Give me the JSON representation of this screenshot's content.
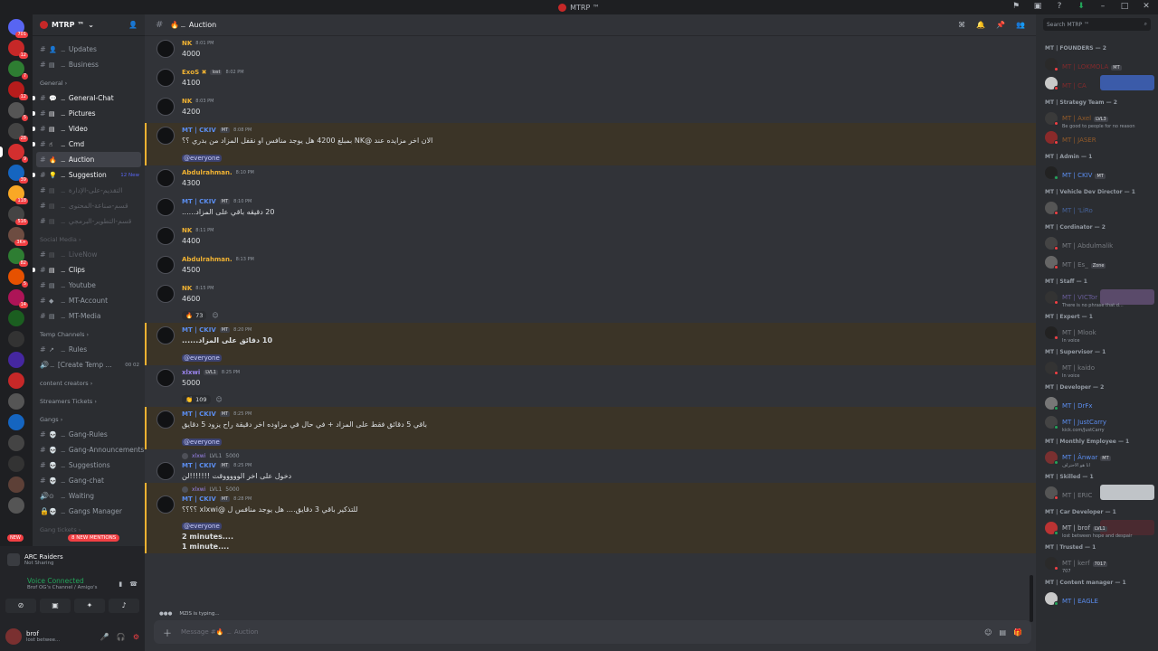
{
  "window": {
    "title": "MTRP ™"
  },
  "server": {
    "name": "MTRP ™"
  },
  "guild_badges": [
    "701",
    "12",
    "7",
    "12",
    "5",
    "28",
    "9",
    "39",
    "118",
    "516",
    "3K+",
    "82",
    "5",
    "14"
  ],
  "channels": {
    "top": [
      {
        "emoji": "👤",
        "name": "Updates"
      },
      {
        "emoji": "▤",
        "name": "Business"
      }
    ],
    "general_category": "General",
    "general": [
      {
        "emoji": "💬",
        "name": "General-Chat",
        "unread": true
      },
      {
        "emoji": "▤",
        "name": "Pictures",
        "unread": true
      },
      {
        "emoji": "▤",
        "name": "Video",
        "unread": true
      },
      {
        "emoji": "☝",
        "name": "Cmd",
        "unread": true
      },
      {
        "emoji": "🔥",
        "name": "Auction",
        "selected": true
      },
      {
        "emoji": "💡",
        "name": "Suggestion",
        "unread": true,
        "right": "12 New"
      },
      {
        "emoji": "▤",
        "name": "التقديم-على-الإدارة",
        "muted": true
      },
      {
        "emoji": "▤",
        "name": "قسم-صناعة-المحتوى",
        "muted": true
      },
      {
        "emoji": "▤",
        "name": "قسم-التطوير-البرمجي",
        "muted": true
      }
    ],
    "social_category": "Social Media",
    "social": [
      {
        "emoji": "▤",
        "name": "LiveNow",
        "muted": true
      },
      {
        "emoji": "▤",
        "name": "Clips",
        "unread": true
      },
      {
        "emoji": "▤",
        "name": "Youtube"
      },
      {
        "emoji": "◆",
        "name": "MT-Account"
      },
      {
        "emoji": "▤",
        "name": "MT-Media"
      }
    ],
    "temp_category": "Temp Channels",
    "temp": [
      {
        "emoji": "↗",
        "name": "Rules"
      },
      {
        "emoji": "",
        "name": "[Create Temp ...",
        "voice": true,
        "right": "00  02"
      }
    ],
    "content_category": "content creators",
    "streamers_category": "Streamers Tickets",
    "gangs_category": "Gangs",
    "gangs": [
      {
        "emoji": "💀",
        "name": "Gang-Rules"
      },
      {
        "emoji": "💀",
        "name": "Gang-Announcements"
      },
      {
        "emoji": "💀",
        "name": "Suggestions"
      },
      {
        "emoji": "💀",
        "name": "Gang-chat"
      },
      {
        "emoji": "⊙",
        "name": "Waiting",
        "voice": true
      },
      {
        "emoji": "💀",
        "name": "Gangs Manager",
        "locked": true
      }
    ],
    "gang_tickets_category": "Gang tickets"
  },
  "new_pill": "NEW",
  "mentions_pill": "8 NEW MENTIONS",
  "activity": {
    "game": "ARC Raiders",
    "status": "Not Sharing"
  },
  "voice": {
    "status": "Voice Connected",
    "channel": "Brof OG's Channel / Amigo's"
  },
  "user": {
    "name": "brof",
    "status": "lost betwee..."
  },
  "chat": {
    "channel": "Auction",
    "composer_placeholder": "Message #🔥 ﹘ Auction",
    "typing": "MZIS is typing..."
  },
  "messages": [
    {
      "name": "NK",
      "color": "#f0b232",
      "time": "8:01 PM",
      "text": "4000"
    },
    {
      "name": "ExoS ✖",
      "color": "#f0b232",
      "tag": "lost",
      "time": "8:02 PM",
      "text": "4100"
    },
    {
      "name": "NK",
      "color": "#f0b232",
      "time": "8:03 PM",
      "text": "4200"
    },
    {
      "name": "MT | CKIV",
      "color": "#5b8def",
      "tag": "MT",
      "time": "8:08 PM",
      "text": "الان اخر مزايده عند @NK بمبلغ 4200 هل يوجد منافس او نقفل المزاد من بدري ؟؟",
      "rtl": true,
      "mention": true,
      "everyone": "@everyone"
    },
    {
      "name": "Abdulrahman.",
      "color": "#f0b232",
      "time": "8:10 PM",
      "text": "4300"
    },
    {
      "name": "MT | CKIV",
      "color": "#5b8def",
      "tag": "MT",
      "time": "8:10 PM",
      "text": "20 دقيقه باقي على المزاد......",
      "rtl": true
    },
    {
      "name": "NK",
      "color": "#f0b232",
      "time": "8:11 PM",
      "text": "4400"
    },
    {
      "name": "Abdulrahman.",
      "color": "#f0b232",
      "time": "8:13 PM",
      "text": "4500"
    },
    {
      "name": "NK",
      "color": "#f0b232",
      "time": "8:15 PM",
      "text": "4600",
      "reaction": {
        "emoji": "🔥",
        "count": "73"
      }
    },
    {
      "name": "MT | CKIV",
      "color": "#5b8def",
      "tag": "MT",
      "time": "8:20 PM",
      "text": "10 دقائق على المزاد......",
      "rtl": true,
      "bold": true,
      "mention": true,
      "everyone": "@everyone"
    },
    {
      "name": "xlxwi",
      "color": "#9b84ee",
      "tag": "LVL1",
      "time": "8:25 PM",
      "text": "5000",
      "reaction": {
        "emoji": "👏",
        "count": "109"
      }
    },
    {
      "name": "MT | CKIV",
      "color": "#5b8def",
      "tag": "MT",
      "time": "8:25 PM",
      "text": "باقي 5 دقائق فقط على المزاد + في حال في مزاوده اخر دقيقة راح يزود 5 دقايق",
      "rtl": true,
      "mention": true,
      "everyone": "@everyone"
    },
    {
      "name": "MT | CKIV",
      "color": "#5b8def",
      "tag": "MT",
      "time": "8:25 PM",
      "text": "دخول على اخر الوووووقت !!!!!!!لن",
      "rtl": true,
      "reply": {
        "name": "xlxwi",
        "tag": "LVL1",
        "text": "5000"
      }
    },
    {
      "name": "MT | CKIV",
      "color": "#5b8def",
      "tag": "MT",
      "time": "8:28 PM",
      "text": "للتذكير باقي 3 دقايق.... هل يوجد منافس ل @xlxwi ؟؟؟؟",
      "rtl": true,
      "mention": true,
      "reply": {
        "name": "xlxwi",
        "tag": "LVL1",
        "text": "5000"
      },
      "everyone": "@everyone",
      "extra": [
        "2 minutes....",
        "1 minute...."
      ]
    }
  ],
  "members": {
    "search_placeholder": "Search MTRP ™",
    "groups": [
      {
        "title": "MT | FOUNDERS — 2",
        "items": [
          {
            "name": "MT | LOKMOLA",
            "color": "#c62828",
            "tag": "MT",
            "dim": true
          },
          {
            "name": "MT | CA",
            "color": "#c62828",
            "dim": true,
            "banner": "#3b5ba9"
          }
        ]
      },
      {
        "title": "MT | Strategy Team — 2",
        "items": [
          {
            "name": "MT | Axel",
            "color": "#e67e22",
            "tag": "LVL3",
            "sub": "Be good to people for no reason",
            "dim": true
          },
          {
            "name": "MT | JASER",
            "color": "#e67e22",
            "dim": true
          }
        ]
      },
      {
        "title": "MT | Admin — 1",
        "items": [
          {
            "name": "MT | CKIV",
            "color": "#5b8def",
            "tag": "MT",
            "online": true
          }
        ]
      },
      {
        "title": "MT | Vehicle Dev Director — 1",
        "items": [
          {
            "name": "MT | 'LiRo",
            "color": "#5b8def",
            "dim": true
          }
        ]
      },
      {
        "title": "MT | Cordinator — 2",
        "items": [
          {
            "name": "MT | Abdulmalik",
            "color": "#b5bac1",
            "dim": true
          },
          {
            "name": "MT | Es_",
            "color": "#b5bac1",
            "tag": "Zone",
            "dim": true
          }
        ]
      },
      {
        "title": "MT | Staff — 1",
        "items": [
          {
            "name": "MT | VICTor",
            "color": "#9b84ee",
            "sub": "There is no phrase that d...",
            "dim": true,
            "banner": "#5a4a6a"
          }
        ]
      },
      {
        "title": "MT | Expert — 1",
        "items": [
          {
            "name": "MT | Mlook",
            "color": "#b5bac1",
            "sub": "In voice",
            "dim": true
          }
        ]
      },
      {
        "title": "MT | Supervisor — 1",
        "items": [
          {
            "name": "MT | kaido",
            "color": "#b5bac1",
            "sub": "In voice",
            "dim": true
          }
        ]
      },
      {
        "title": "MT | Developer — 2",
        "items": [
          {
            "name": "MT | DrFx",
            "color": "#5b8def",
            "online": true
          },
          {
            "name": "MT | JustCarry",
            "color": "#5b8def",
            "sub": "kick.com/JustCarry",
            "online": true
          }
        ]
      },
      {
        "title": "MT | Monthly Employee — 1",
        "items": [
          {
            "name": "MT | Ânwar",
            "color": "#5b8def",
            "tag": "MT",
            "sub": "انا هو الاحتراف",
            "online": true
          }
        ]
      },
      {
        "title": "MT | Skilled — 1",
        "items": [
          {
            "name": "MT | ERIC",
            "color": "#b5bac1",
            "dim": true,
            "banner": "#c0c4c8"
          }
        ]
      },
      {
        "title": "MT | Car Developer — 1",
        "items": [
          {
            "name": "MT | brof",
            "color": "#b5bac1",
            "tag": "LVL1",
            "sub": "lost between hope and despair",
            "online": true,
            "banner": "#4a2a30"
          }
        ]
      },
      {
        "title": "MT | Trusted — 1",
        "items": [
          {
            "name": "MT | kerf",
            "color": "#b5bac1",
            "tag": "7017",
            "sub": "707",
            "dim": true
          }
        ]
      },
      {
        "title": "MT | Content manager — 1",
        "items": [
          {
            "name": "MT | EAGLE",
            "color": "#5b8def",
            "online": true
          }
        ]
      }
    ]
  }
}
